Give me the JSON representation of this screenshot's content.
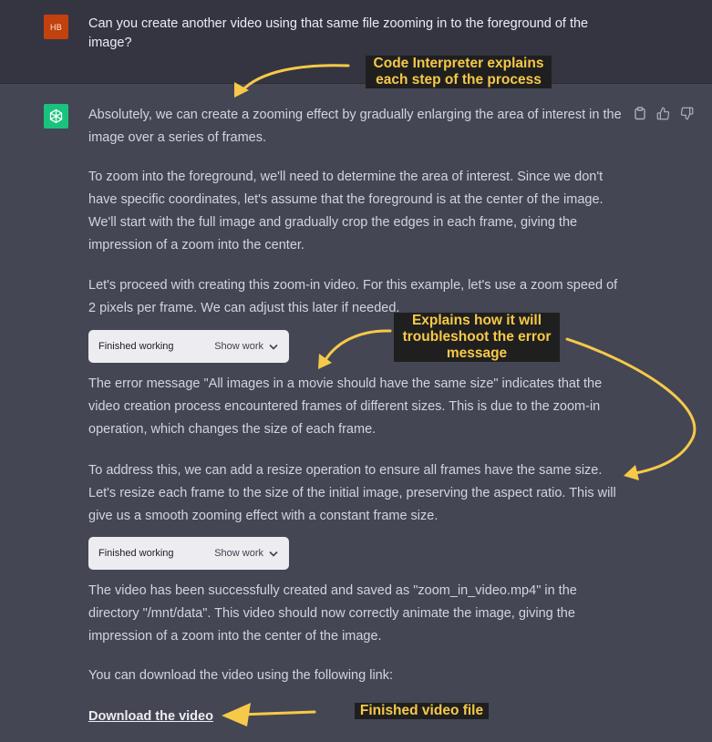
{
  "user": {
    "avatar_initials": "HB",
    "message": "Can you create another video using that same file zooming in to the foreground of the image?"
  },
  "assistant": {
    "icons": [
      "openai-logo-icon",
      "copy-icon",
      "thumbs-up-icon",
      "thumbs-down-icon"
    ],
    "paragraphs": [
      "Absolutely, we can create a zooming effect by gradually enlarging the area of interest in the image over a series of frames.",
      "To zoom into the foreground, we'll need to determine the area of interest. Since we don't have specific coordinates, let's assume that the foreground is at the center of the image. We'll start with the full image and gradually crop the edges in each frame, giving the impression of a zoom into the center.",
      "Let's proceed with creating this zoom-in video. For this example, let's use a zoom speed of 2 pixels per frame. We can adjust this later if needed.",
      "The error message \"All images in a movie should have the same size\" indicates that the video creation process encountered frames of different sizes. This is due to the zoom-in operation, which changes the size of each frame.",
      "To address this, we can add a resize operation to ensure all frames have the same size. Let's resize each frame to the size of the initial image, preserving the aspect ratio. This will give us a smooth zooming effect with a constant frame size.",
      "The video has been successfully created and saved as \"zoom_in_video.mp4\" in the directory \"/mnt/data\". This video should now correctly animate the image, giving the impression of a zoom into the center of the image.",
      "You can download the video using the following link:"
    ],
    "work_boxes": [
      {
        "status": "Finished working",
        "toggle": "Show work"
      },
      {
        "status": "Finished working",
        "toggle": "Show work"
      }
    ],
    "download_link": "Download the video"
  },
  "annotations": {
    "callout_1": [
      "Code Interpreter explains",
      "each step of the process"
    ],
    "callout_2": [
      "Explains how it will",
      "troubleshoot the error",
      "message"
    ],
    "callout_3": [
      "Finished video file"
    ],
    "color": "#f7c948"
  },
  "colors": {
    "background": "#444654",
    "user_background": "#343541",
    "user_avatar": "#c2410c",
    "assistant_avatar": "#19c37d",
    "annotation_yellow": "#f7c948"
  }
}
